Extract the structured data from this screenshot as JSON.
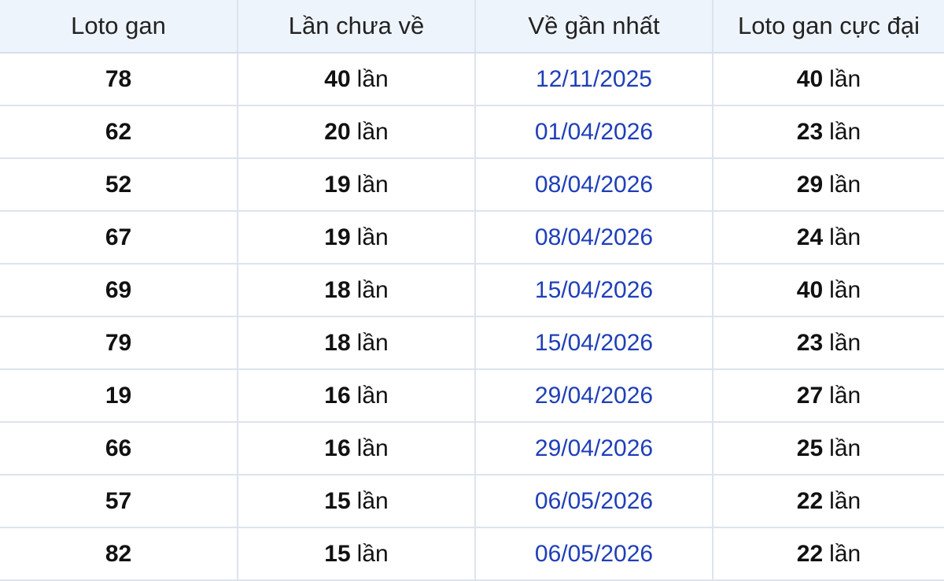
{
  "table": {
    "headers": [
      "Loto gan",
      "Lần chưa về",
      "Về gần nhất",
      "Loto gan cực đại"
    ],
    "unit": "lần",
    "rows": [
      {
        "number": "78",
        "missed": "40",
        "last_date": "12/11/2025",
        "max_gap": "40"
      },
      {
        "number": "62",
        "missed": "20",
        "last_date": "01/04/2026",
        "max_gap": "23"
      },
      {
        "number": "52",
        "missed": "19",
        "last_date": "08/04/2026",
        "max_gap": "29"
      },
      {
        "number": "67",
        "missed": "19",
        "last_date": "08/04/2026",
        "max_gap": "24"
      },
      {
        "number": "69",
        "missed": "18",
        "last_date": "15/04/2026",
        "max_gap": "40"
      },
      {
        "number": "79",
        "missed": "18",
        "last_date": "15/04/2026",
        "max_gap": "23"
      },
      {
        "number": "19",
        "missed": "16",
        "last_date": "29/04/2026",
        "max_gap": "27"
      },
      {
        "number": "66",
        "missed": "16",
        "last_date": "29/04/2026",
        "max_gap": "25"
      },
      {
        "number": "57",
        "missed": "15",
        "last_date": "06/05/2026",
        "max_gap": "22"
      },
      {
        "number": "82",
        "missed": "15",
        "last_date": "06/05/2026",
        "max_gap": "22"
      }
    ]
  },
  "colors": {
    "header_bg": "#eef4fc",
    "border": "#dde3ee",
    "date_text": "#1f3fb8"
  }
}
